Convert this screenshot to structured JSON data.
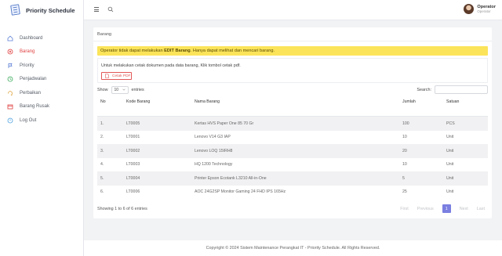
{
  "app": {
    "title": "Priority Schedule"
  },
  "sidebar": {
    "items": [
      {
        "label": "Dashboard",
        "icon": "home-icon"
      },
      {
        "label": "Barang",
        "icon": "circle-x-icon"
      },
      {
        "label": "Priority",
        "icon": "flag-icon"
      },
      {
        "label": "Penjadwalan",
        "icon": "clock-icon"
      },
      {
        "label": "Perbaikan",
        "icon": "wrench-icon"
      },
      {
        "label": "Barang Rusak",
        "icon": "box-icon"
      },
      {
        "label": "Log Out",
        "icon": "logout-icon"
      }
    ],
    "active_index": 1
  },
  "user": {
    "name": "Operator",
    "role": "Operator"
  },
  "page": {
    "title": "Barang",
    "alert_prefix": "Operator tidak dapat melakukan ",
    "alert_bold": "EDIT Barang",
    "alert_suffix": ". Hanya dapat melihat dan mencari barang.",
    "info_text": "Untuk melakukan cetak dokumen pada data barang, Klik tombol cetak pdf.",
    "pdf_button": "Cetak PDF"
  },
  "table_controls": {
    "show_label": "Show",
    "entries_value": "10",
    "entries_label": "entries",
    "search_label": "Search:"
  },
  "table": {
    "columns": [
      "No",
      "Kode Barang",
      "Nama Barang",
      "Jumlah",
      "Satuan"
    ],
    "rows": [
      [
        "1.",
        "LT0005",
        "Kertas HVS Paper One 85 70 Gr",
        "100",
        "PCS"
      ],
      [
        "2.",
        "LT0001",
        "Lenovo V14 G3 IAP",
        "10",
        "Unit"
      ],
      [
        "3.",
        "LT0002",
        "Lenovo LOQ 15IRH8",
        "20",
        "Unit"
      ],
      [
        "4.",
        "LT0003",
        "HQ 1200 Technology",
        "10",
        "Unit"
      ],
      [
        "5.",
        "LT0004",
        "Printer Epson Ecotank L3210 All-in-One",
        "5",
        "Unit"
      ],
      [
        "6.",
        "LT0006",
        "AOC 24G2SP Monitor Gaming 24 FHD IPS 165Hz",
        "25",
        "Unit"
      ]
    ]
  },
  "pagination": {
    "info": "Showing 1 to 6 of 6 entries",
    "first": "First",
    "previous": "Previous",
    "current": "1",
    "next": "Next",
    "last": "Last"
  },
  "footer": {
    "text": "Copyright © 2024 Sistem Maintenance Perangkat IT - Priority Schedule. All Rights Reserved."
  },
  "colors": {
    "accent_active": "#e03e3e",
    "alert_bg": "#fbe45a",
    "pager_current": "#7a7fe0"
  }
}
